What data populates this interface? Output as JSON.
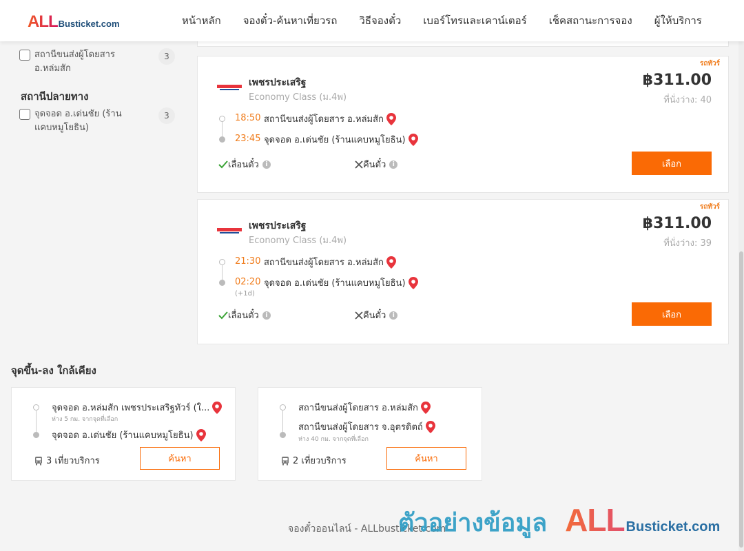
{
  "header": {
    "logo_all": "ALL",
    "logo_rest": "Busticket.com",
    "nav": [
      "หน้าหลัก",
      "จองตั๋ว-ค้นหาเที่ยวรถ",
      "วิธีจองตั๋ว",
      "เบอร์โทรและเคาน์เตอร์",
      "เช็คสถานะการจอง",
      "ผู้ให้บริการ"
    ]
  },
  "filters": {
    "origin_item": {
      "label": "สถานีขนส่งผู้โดยสาร อ.หล่มสัก",
      "count": "3"
    },
    "destination_title": "สถานีปลายทาง",
    "destination_item": {
      "label": "จุดจอด อ.เด่นชัย (ร้านแคบหมูโยธิน)",
      "count": "3"
    }
  },
  "trips": [
    {
      "tag": "รถทัวร์",
      "operator": "เพชรประเสริฐ",
      "class": "Economy Class (ม.4พ)",
      "price": "฿311.00",
      "seats": "ที่นั่งว่าง: 40",
      "depart_time": "18:50",
      "depart_stop": "สถานีขนส่งผู้โดยสาร อ.หล่มสัก",
      "arrive_time": "23:45",
      "arrive_stop": "จุดจอด อ.เด่นชัย (ร้านแคบหมูโยธิน)",
      "next_day": "",
      "change": "เลื่อนตั๋ว",
      "refund": "คืนตั๋ว",
      "button": "เลือก"
    },
    {
      "tag": "รถทัวร์",
      "operator": "เพชรประเสริฐ",
      "class": "Economy Class (ม.4พ)",
      "price": "฿311.00",
      "seats": "ที่นั่งว่าง: 39",
      "depart_time": "21:30",
      "depart_stop": "สถานีขนส่งผู้โดยสาร อ.หล่มสัก",
      "arrive_time": "02:20",
      "arrive_stop": "จุดจอด อ.เด่นชัย (ร้านแคบหมูโยธิน)",
      "next_day": "(+1d)",
      "change": "เลื่อนตั๋ว",
      "refund": "คืนตั๋ว",
      "button": "เลือก"
    }
  ],
  "nearby": {
    "title": "จุดขึ้น-ลง ใกล้เคียง",
    "cards": [
      {
        "from": "จุดจอด อ.หล่มสัก เพชรประเสริฐทัวร์ (ใ...",
        "from_note": "ห่าง 5 กม. จากจุดที่เลือก",
        "to": "จุดจอด อ.เด่นชัย (ร้านแคบหมูโยธิน)",
        "to_note": "",
        "trips": "3 เที่ยวบริการ",
        "button": "ค้นหา"
      },
      {
        "from": "สถานีขนส่งผู้โดยสาร อ.หล่มสัก",
        "from_note": "",
        "to": "สถานีขนส่งผู้โดยสาร จ.อุตรดิตถ์",
        "to_note": "ห่าง 40 กม. จากจุดที่เลือก",
        "trips": "2 เที่ยวบริการ",
        "button": "ค้นหา"
      }
    ]
  },
  "footer": "จองตั๋วออนไลน์ - ALLbusticket.com",
  "watermark": {
    "text": "ตัวอย่างข้อมูล",
    "all": "ALL",
    "rest": "Busticket.com"
  },
  "colors": {
    "accent": "#fa6a05",
    "time": "#f07b1a",
    "pin": "#e8343c",
    "check": "#3aa335"
  }
}
